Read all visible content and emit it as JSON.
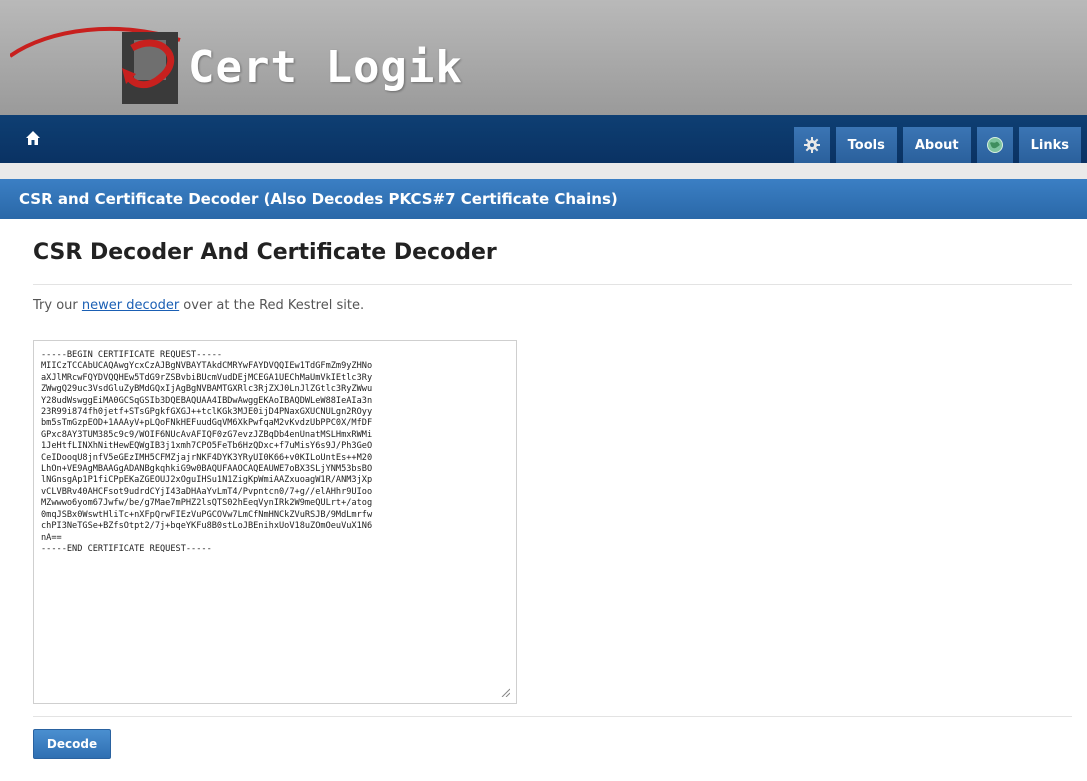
{
  "header": {
    "logo_text": "Cert Logik",
    "logo_name": "cert-logik-logo"
  },
  "nav": {
    "home_icon": "home-icon",
    "settings_icon": "gear-icon",
    "tools_label": "Tools",
    "about_label": "About",
    "links_icon": "globe-icon",
    "links_label": "Links"
  },
  "title_bar": "CSR and Certificate Decoder (Also Decodes PKCS#7 Certificate Chains)",
  "page": {
    "heading": "CSR Decoder And Certificate Decoder",
    "intro_prefix": "Try our ",
    "intro_link": "newer decoder",
    "intro_suffix": " over at the Red Kestrel site."
  },
  "csr_input": "-----BEGIN CERTIFICATE REQUEST-----\nMIICzTCCAbUCAQAwgYcxCzAJBgNVBAYTAkdCMRYwFAYDVQQIEw1TdGFmZm9yZHNo\naXJlMRcwFQYDVQQHEw5TdG9rZSBvbiBUcmVudDEjMCEGA1UEChMaUmVkIEtlc3Ry\nZWwgQ29uc3VsdGluZyBMdGQxIjAgBgNVBAMTGXRlc3RjZXJ0LnJlZGtlc3RyZWwu\nY28udWswggEiMA0GCSqGSIb3DQEBAQUAA4IBDwAwggEKAoIBAQDWLeW88IeAIa3n\n23R99i874fh0jetf+STsGPgkfGXGJ++tclKGk3MJE0ijD4PNaxGXUCNULgn2ROyy\nbm5sTmGzpEOD+1AAAyV+pLQoFNkHEFuudGqVM6XkPwfqaM2vKvdzUbPPC0X/MfDF\nGPxc8AY3TUM385c9c9/WOIF6NUcAvAFIQF0zG7evzJZBqDb4enUnatMSLHmxRWMi\n1JeHtfLINXhNitHewEQWgIB3j1xmh7CPO5FeTb6HzQDxc+f7uMisY6s9J/Ph3GeO\nCeIDooqU8jnfV5eGEzIMH5CFMZjajrNKF4DYK3YRyUI0K66+v0KILoUntEs++M20\nLhOn+VE9AgMBAAGgADANBgkqhkiG9w0BAQUFAAOCAQEAUWE7oBX3SLjYNM53bsBO\nlNGnsgAp1P1fiCPpEKaZGEOUJ2xOguIHSu1N1ZigKpWmiAAZxuoagW1R/ANM3jXp\nvCLVBRv40AHCFsot9udrdCYjI43aDHAaYvLmT4/Pvpntcn0/7+g//elAHhr9UIoo\nMZwwwo6yom67Jwfw/be/g7Mae7mPHZ2lsQTS02hEeqVynIRk2W9meQULrt+/atog\n0mqJSBx0WswtHliTc+nXFpQrwFIEzVuPGCOVw7LmCfNmHNCkZVuRSJB/9MdLmrfw\nchPI3NeTGSe+BZfsOtpt2/7j+bqeYKFu8B0stLoJBEnihxUoV18uZOmOeuVuX1N6\nnA==\n-----END CERTIFICATE REQUEST-----",
  "decode_button": "Decode"
}
